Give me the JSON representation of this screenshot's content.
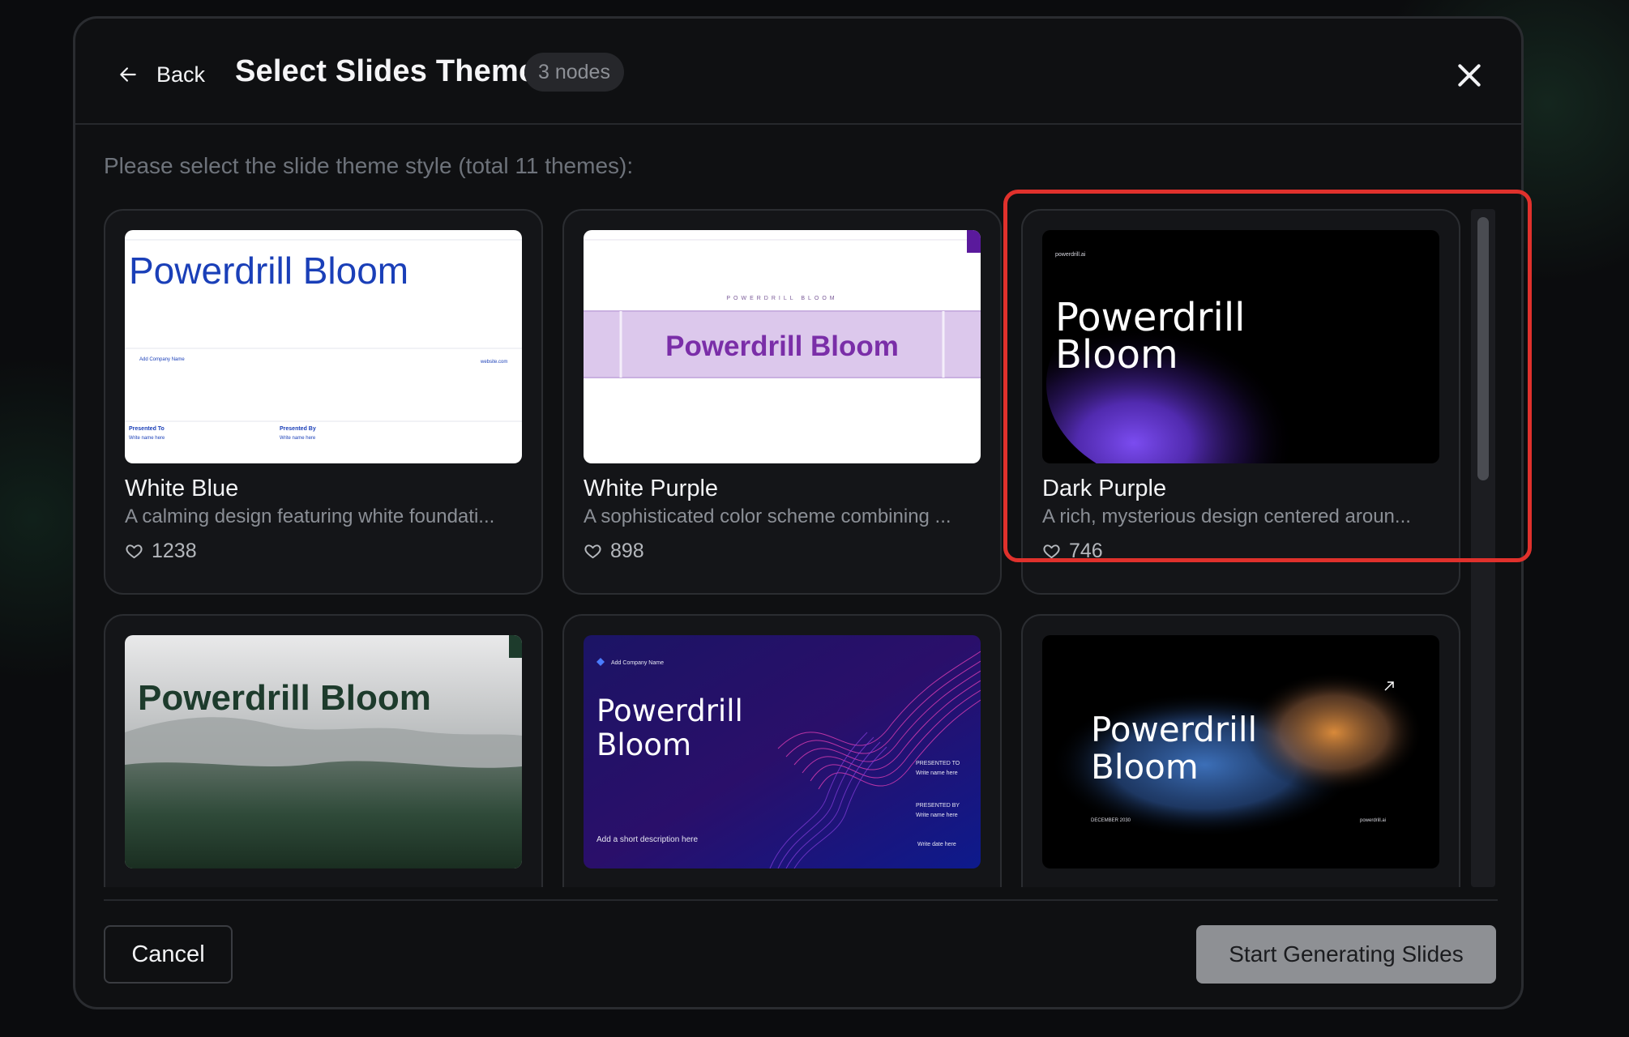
{
  "header": {
    "back_label": "Back",
    "title": "Select Slides Theme",
    "nodes_badge": "3 nodes"
  },
  "subtitle": "Please select the slide theme style (total 11 themes):",
  "themes": [
    {
      "name": "White Blue",
      "description": "A calming design featuring white foundati...",
      "likes": "1238"
    },
    {
      "name": "White Purple",
      "description": "A sophisticated color scheme combining ...",
      "likes": "898"
    },
    {
      "name": "Dark Purple",
      "description": "A rich, mysterious design centered aroun...",
      "likes": "746"
    },
    {
      "name": "",
      "description": "",
      "likes": ""
    },
    {
      "name": "",
      "description": "",
      "likes": ""
    },
    {
      "name": "",
      "description": "",
      "likes": ""
    }
  ],
  "thumbnails": {
    "bloom_title": "Powerdrill Bloom",
    "bloom_line1": "Powerdrill",
    "bloom_line2": "Bloom",
    "white_blue": {
      "company": "Add Company Name",
      "website": "website.com",
      "presented_to": "Presented To",
      "presented_by": "Presented By",
      "write_name": "Write name here"
    },
    "white_purple": {
      "caps": "POWERDRILL BLOOM"
    },
    "dark_purple": {
      "brand": "powerdrill.ai"
    },
    "wave": {
      "company": "Add Company Name",
      "presented_to": "PRESENTED TO",
      "presented_by": "PRESENTED BY",
      "write_name": "Write name here",
      "short_desc": "Add a short description here",
      "write_date": "Write date here"
    },
    "dark_blob": {
      "date": "DECEMBER 2030",
      "brand": "powerdrill.ai"
    }
  },
  "footer": {
    "cancel_label": "Cancel",
    "start_label": "Start Generating Slides"
  },
  "selected_theme": "Dark Purple",
  "colors": {
    "highlight": "#e0312c",
    "blue_text": "#1a3fb8",
    "purple_text": "#7a2ea8",
    "green_text": "#1d3b2c"
  }
}
